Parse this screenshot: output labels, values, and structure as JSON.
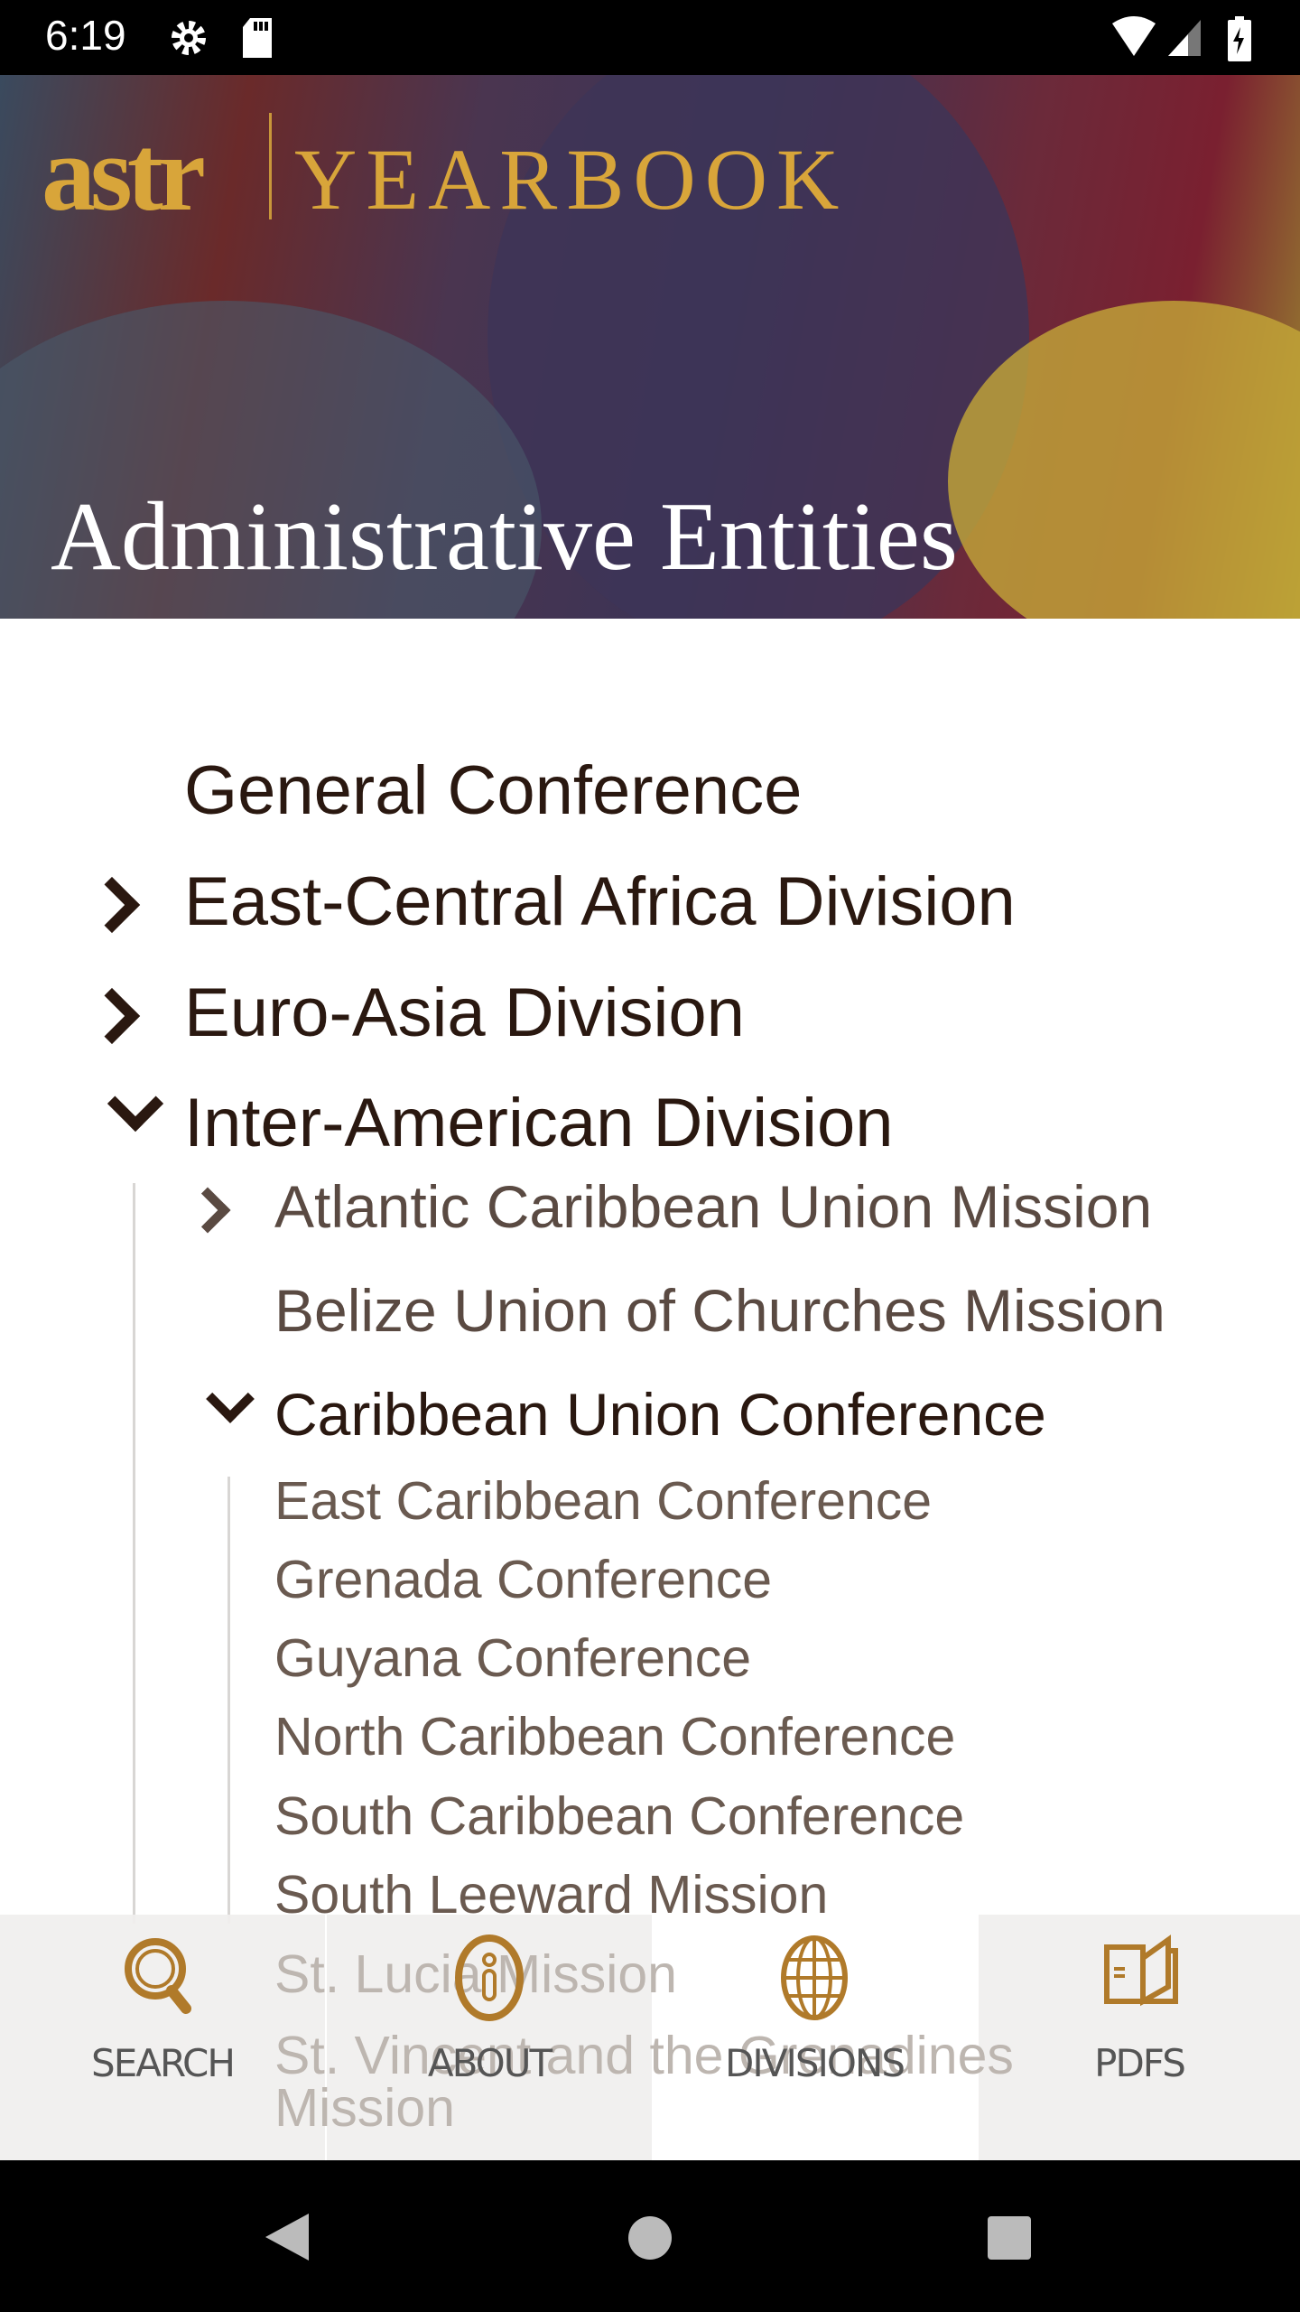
{
  "status_bar": {
    "time": "6:19",
    "icons": [
      "gear-icon",
      "sd-card-icon",
      "wifi-icon",
      "cell-signal-icon",
      "battery-charging-icon"
    ]
  },
  "header": {
    "logo_text": "astr",
    "logo_subtitle": "YEARBOOK",
    "title": "Administrative Entities"
  },
  "tree": {
    "general_conference": "General Conference",
    "east_central_africa": "East-Central Africa Division",
    "euro_asia": "Euro-Asia Division",
    "inter_american": "Inter-American Division",
    "children": {
      "atlantic_caribbean": "Atlantic Caribbean Union Mission",
      "belize": "Belize Union of Churches Mission",
      "caribbean_union": "Caribbean Union Conference",
      "caribbean_children": [
        "East Caribbean Conference",
        "Grenada Conference",
        "Guyana Conference",
        "North Caribbean Conference",
        "South Caribbean Conference",
        "South Leeward Mission",
        "St. Lucia Mission",
        "St. Vincent and the Grenadines",
        "Mission"
      ]
    }
  },
  "bottom_nav": {
    "items": [
      {
        "label": "SEARCH",
        "icon": "search-icon"
      },
      {
        "label": "ABOUT",
        "icon": "info-icon"
      },
      {
        "label": "DIVISIONS",
        "icon": "globe-icon",
        "selected": true
      },
      {
        "label": "PDFS",
        "icon": "book-icon"
      }
    ]
  },
  "colors": {
    "accent": "#b07a2a",
    "text_dark": "#2a1810",
    "text_mid": "#5a4a42"
  }
}
